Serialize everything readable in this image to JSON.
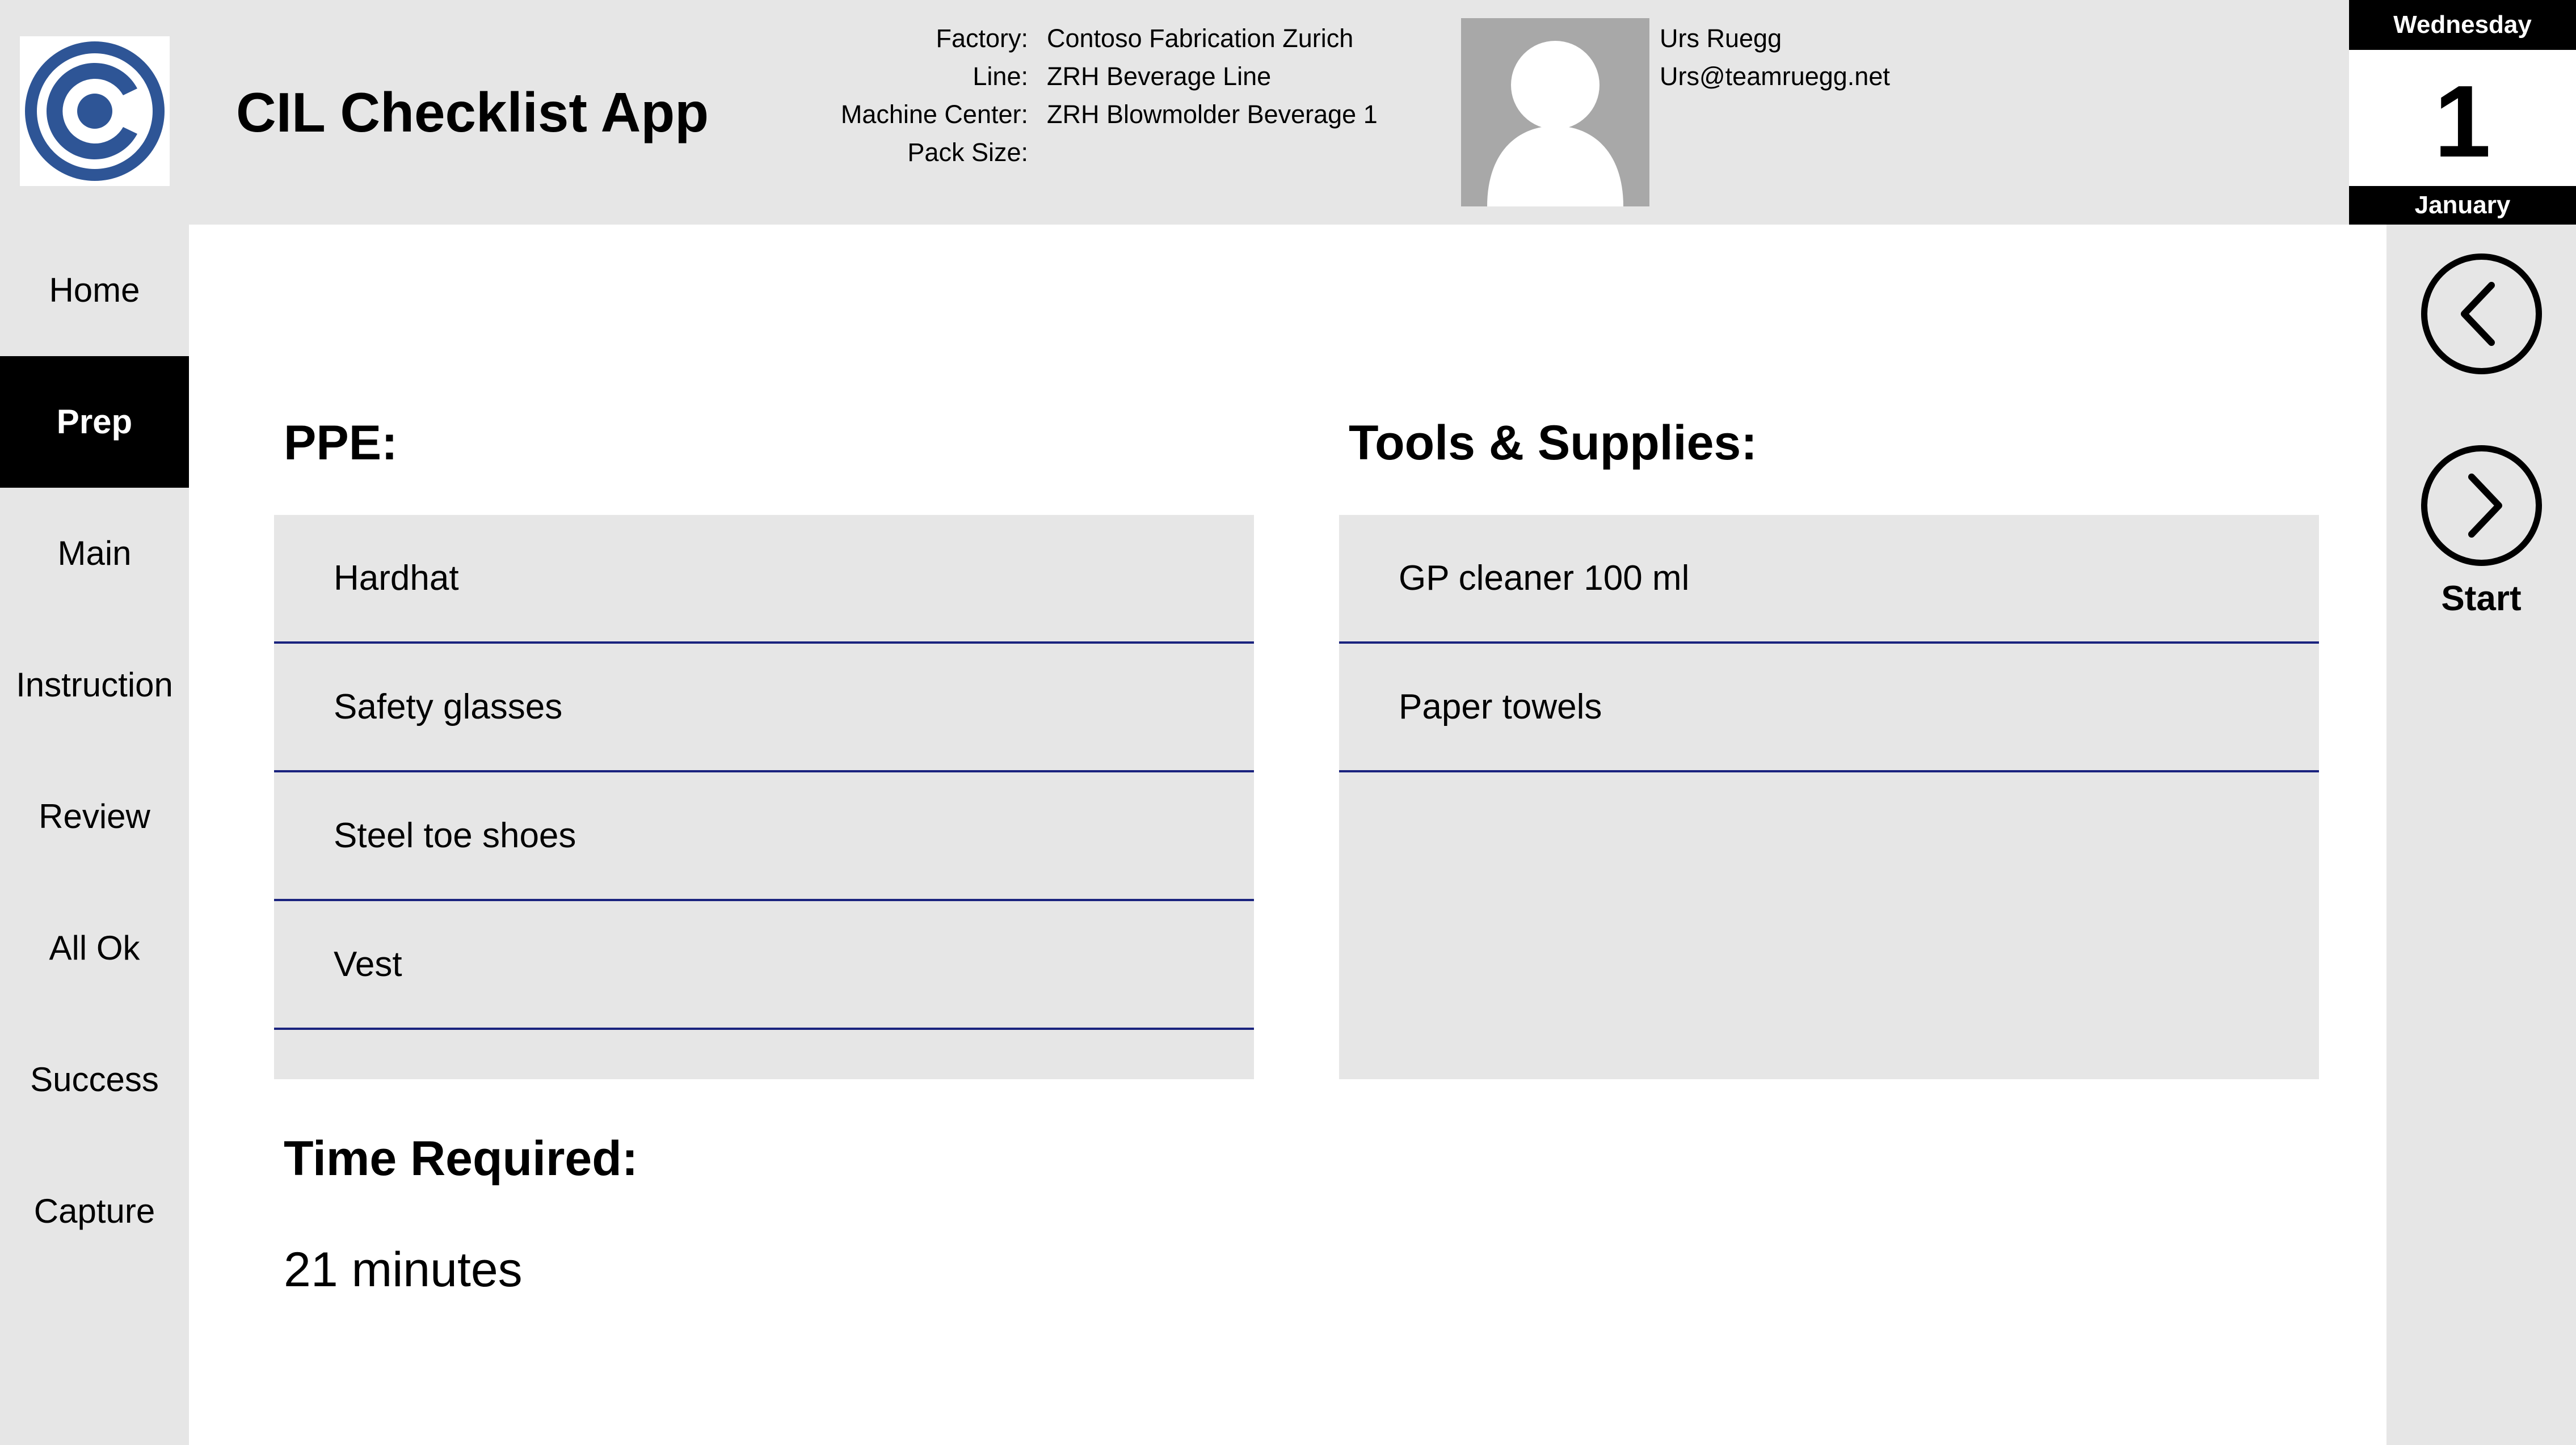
{
  "app": {
    "title": "CIL Checklist App"
  },
  "header": {
    "labels": {
      "factory": "Factory:",
      "line": "Line:",
      "machine_center": "Machine Center:",
      "pack_size": "Pack Size:"
    },
    "values": {
      "factory": "Contoso Fabrication Zurich",
      "line": "ZRH Beverage Line",
      "machine_center": "ZRH Blowmolder Beverage 1",
      "pack_size": ""
    },
    "user": {
      "name": "Urs Ruegg",
      "email": "Urs@teamruegg.net",
      "avatar_icon": "person-silhouette-icon"
    },
    "logo_icon": "contoso-c-logo",
    "brand_color": "#2e5596"
  },
  "calendar": {
    "weekday": "Wednesday",
    "day": "1",
    "month": "January"
  },
  "nav": {
    "active": "Prep",
    "items": [
      {
        "label": "Home"
      },
      {
        "label": "Prep"
      },
      {
        "label": "Main"
      },
      {
        "label": "Instruction"
      },
      {
        "label": "Review"
      },
      {
        "label": "All Ok"
      },
      {
        "label": "Success"
      },
      {
        "label": "Capture"
      }
    ]
  },
  "main": {
    "ppe": {
      "title": "PPE:",
      "items": [
        "Hardhat",
        "Safety glasses",
        "Steel toe shoes",
        "Vest"
      ]
    },
    "tools": {
      "title": "Tools & Supplies:",
      "items": [
        "GP cleaner 100 ml",
        "Paper towels"
      ]
    },
    "time": {
      "title": "Time Required:",
      "value": "21 minutes"
    }
  },
  "rail": {
    "back_icon": "chevron-left-circle-icon",
    "next_icon": "chevron-right-circle-icon",
    "start_label": "Start"
  },
  "colors": {
    "divider": "#1a237e",
    "panel": "#e6e6e6",
    "active_nav": "#000000"
  }
}
